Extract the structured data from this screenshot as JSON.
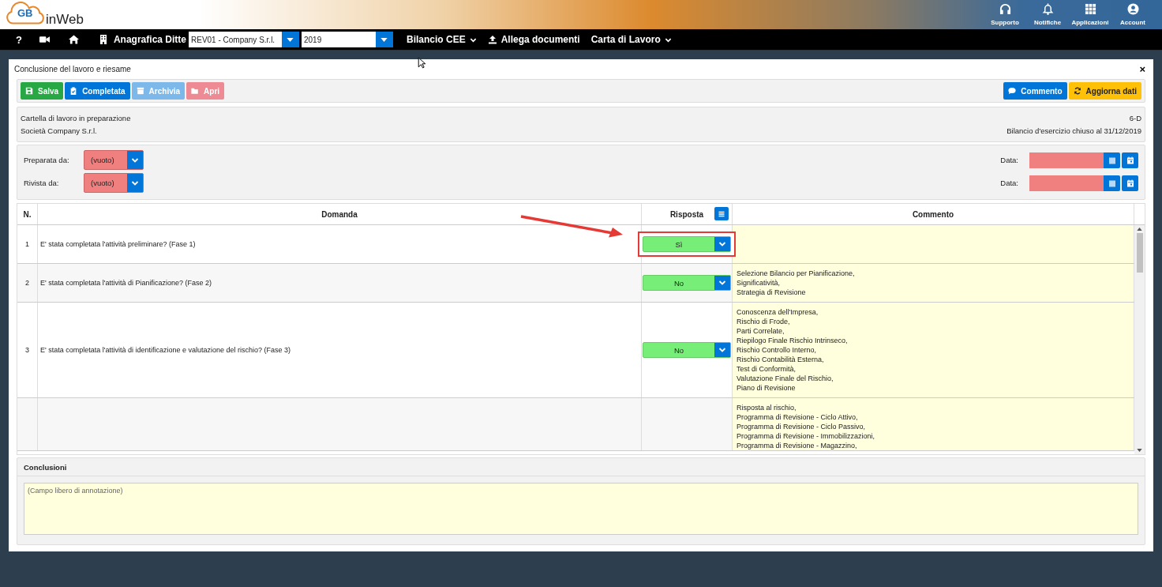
{
  "header": {
    "logo_mark": "GB",
    "logo_text": "inWeb",
    "actions": [
      {
        "label": "Supporto",
        "kind": "headset"
      },
      {
        "label": "Notifiche",
        "kind": "bell"
      },
      {
        "label": "Applicazioni",
        "kind": "grid"
      },
      {
        "label": "Account",
        "kind": "user"
      }
    ]
  },
  "nav": {
    "help": "?",
    "company_label": "Anagrafica Ditte",
    "company_select": "REV01 - Company S.r.l.",
    "year_select": "2019",
    "menus": [
      {
        "label": "Bilancio CEE",
        "kind": "dropdown"
      },
      {
        "label": "Allega documenti",
        "kind": "upload"
      },
      {
        "label": "Carta di Lavoro",
        "kind": "dropdown"
      }
    ]
  },
  "modal": {
    "title": "Conclusione del lavoro e riesame",
    "close": "×",
    "toolbar_left": [
      {
        "label": "Salva",
        "kind": "success",
        "disabled": false
      },
      {
        "label": "Completata",
        "kind": "primary",
        "disabled": false
      },
      {
        "label": "Archivia",
        "kind": "primary",
        "disabled": true
      },
      {
        "label": "Apri",
        "kind": "danger",
        "disabled": true
      }
    ],
    "toolbar_right": [
      {
        "label": "Commento",
        "kind": "primary",
        "disabled": false
      },
      {
        "label": "Aggiorna dati",
        "kind": "warning",
        "disabled": false
      }
    ],
    "info": {
      "status": "Cartella di lavoro in preparazione",
      "company": "Società Company S.r.l.",
      "code": "6-D",
      "period": "Bilancio d'esercizio chiuso al 31/12/2019"
    },
    "assignments": [
      {
        "label": "Preparata da:",
        "value": "(vuoto)",
        "invalid": true,
        "date_label": "Data:",
        "date_invalid": true
      },
      {
        "label": "Rivista da:",
        "value": "(vuoto)",
        "invalid": true,
        "date_label": "Data:",
        "date_invalid": true
      }
    ],
    "table": {
      "columns": [
        "N.",
        "Domanda",
        "Risposta",
        "Commento"
      ],
      "rows": [
        {
          "number": "1",
          "question": "E' stata completata l'attività preliminare? (Fase 1)",
          "answer": "Sì",
          "highlighted": true,
          "comment": []
        },
        {
          "number": "2",
          "question": "E' stata completata l'attività di Pianificazione? (Fase 2)",
          "answer": "No",
          "highlighted": false,
          "comment": [
            "Selezione Bilancio per Pianificazione,",
            "Significatività,",
            "Strategia di Revisione"
          ]
        },
        {
          "number": "3",
          "question": "E' stata completata l'attività di identificazione e valutazione del rischio? (Fase 3)",
          "answer": "No",
          "highlighted": false,
          "comment": [
            "Conoscenza dell'Impresa,",
            "Rischio di Frode,",
            "Parti Correlate,",
            "Riepilogo Finale Rischio Intrinseco,",
            "Rischio Controllo Interno,",
            "Rischio Contabilità Esterna,",
            "Test di Conformità,",
            "Valutazione Finale del Rischio,",
            "Piano di Revisione"
          ]
        },
        {
          "comment": [
            "Risposta al rischio,",
            "Programma di Revisione - Ciclo Attivo,",
            "Programma di Revisione - Ciclo Passivo,",
            "Programma di Revisione - Immobilizzazioni,",
            "Programma di Revisione - Magazzino,"
          ]
        }
      ]
    },
    "conclusion": {
      "title": "Conclusioni",
      "placeholder": "(Campo libero di annotazione)"
    }
  }
}
